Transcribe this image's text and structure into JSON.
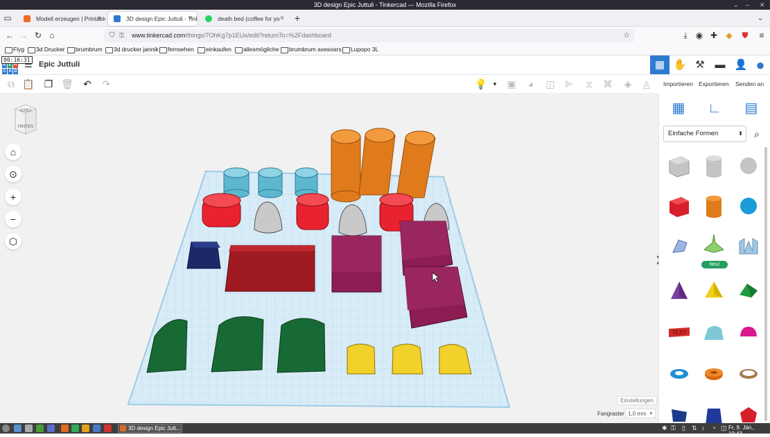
{
  "window": {
    "title": "3D design Epic Juttuli - Tinkercad — Mozilla Firefox"
  },
  "tabs": [
    {
      "label": "Modell erzeugen | Printable",
      "fav_color": "#f06a28",
      "close": "×"
    },
    {
      "label": "3D design Epic Juttuli - Tink",
      "fav_color": "#2e7ad1",
      "close": "×"
    },
    {
      "label": "death bed (coffee for yo",
      "fav_color": "#1ed760",
      "close": "×"
    }
  ],
  "new_tab": "+",
  "nav": {
    "back": "←",
    "forward": "→",
    "reload": "↻",
    "home": "⌂",
    "url_domain": "www.tinkercad.com",
    "url_rest": "/things/7OhKg7p1EUx/edit?returnTo=%2Fdashboard"
  },
  "bookmarks": [
    "Flyg",
    "3d Drucker",
    "brumbrum",
    "3d drucker jannik",
    "fernsehen",
    "einkaufen",
    "allesmögliche",
    "brumbrum axesoars",
    "Lupopo 3L"
  ],
  "app": {
    "timer": "00:16:31",
    "logo_letters": [
      "T",
      "I",
      "N",
      "K",
      "E",
      "R",
      "C",
      "A",
      "D"
    ],
    "project_title": "Epic Juttuli",
    "top_icons": [
      "grid-view-icon",
      "hand-icon",
      "pickaxe-icon",
      "bricks-icon",
      "add-user-icon",
      "user-avatar-icon"
    ],
    "toolbar": {
      "copy": "⧉",
      "paste": "📋",
      "duplicate": "❐",
      "delete": "🗑",
      "undo": "↶",
      "redo": "↷"
    },
    "right_actions": {
      "import": "Importieren",
      "export": "Exportieren",
      "send": "Senden an"
    }
  },
  "viewcube": {
    "top": "N3BO",
    "side": "HINTEN"
  },
  "viewport": {
    "settings": "Einstellungen",
    "snap_label": "Fangraster",
    "snap_value": "1,0 mm"
  },
  "panel": {
    "dropdown": "Einfache Formen",
    "new_badge": "Neu!",
    "shapes": [
      "box-hole",
      "cylinder-hole",
      "sphere-hole",
      "box",
      "cylinder",
      "sphere",
      "scribble",
      "paraboloid-new",
      "text-wave",
      "pyramid-purple",
      "pyramid-yellow",
      "roof-green",
      "text-3d",
      "half-cylinder",
      "half-sphere",
      "torus-blue",
      "tube-orange",
      "ring-brown",
      "blue-part",
      "prism-blue",
      "polygon-red"
    ]
  },
  "taskbar": {
    "window_label": "3D design Epic Jutt...",
    "clock": "Fr, 9. Jän., 19:43"
  },
  "colors": {
    "accent": "#2e7ad1",
    "workplane": "#d8ecf7",
    "red": "#e8232f",
    "orange": "#e07b1c",
    "teal": "#5db7cf",
    "gray": "#c9c9c9",
    "wine": "#8c1d52",
    "navy": "#1b2a66",
    "green": "#176a34",
    "yellow": "#f1d12a"
  }
}
